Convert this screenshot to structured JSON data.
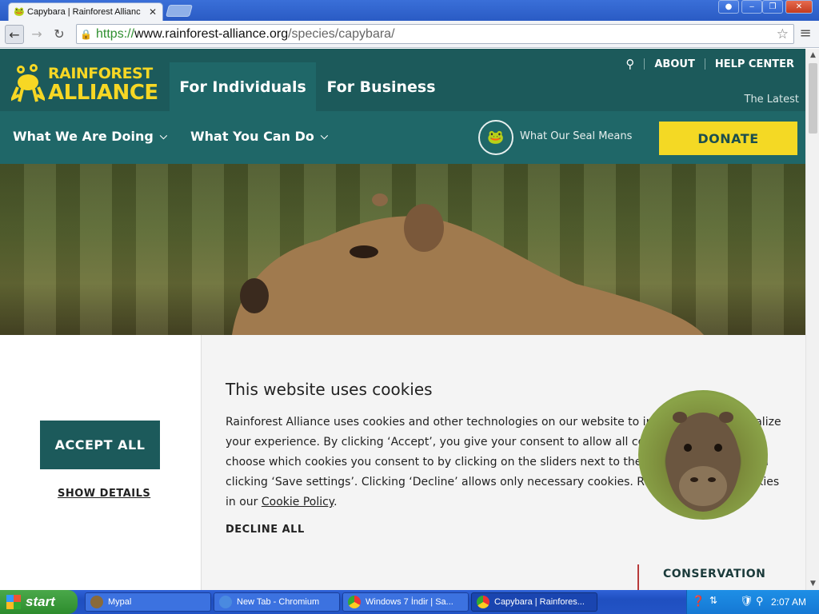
{
  "browser": {
    "tab_title": "Capybara | Rainforest Allianc",
    "url_scheme": "https://",
    "url_host": "www.rainforest-alliance.org",
    "url_path": "/species/capybara/"
  },
  "header": {
    "logo_line1": "RAINFOREST",
    "logo_line2": "ALLIANCE",
    "tab_individuals": "For Individuals",
    "tab_business": "For Business",
    "about": "ABOUT",
    "help_center": "HELP CENTER",
    "latest": "The Latest",
    "nav_doing": "What We Are Doing",
    "nav_can_do": "What You Can Do",
    "seal_text": "What Our Seal Means",
    "donate": "DONATE"
  },
  "cookie": {
    "title": "This website uses cookies",
    "body_part1": "Rainforest Alliance uses cookies and other technologies on our website to improve and personalize your experience. By clicking ‘Accept’, you give your consent to allow all cookies. You can also choose which cookies you consent to by clicking on the sliders next to the cookie categories and clicking ‘Save settings’. Clicking ‘Decline’ allows only necessary cookies. Read more about cookies in our ",
    "body_link": "Cookie Policy",
    "body_end": ".",
    "accept_all": "ACCEPT ALL",
    "show_details": "SHOW DETAILS",
    "decline_all": "DECLINE ALL"
  },
  "section": {
    "conservation": "CONSERVATION"
  },
  "taskbar": {
    "start": "start",
    "tasks": [
      "Mypal",
      "New Tab - Chromium",
      "Windows 7 İndir | Sa...",
      "Capybara | Rainfores..."
    ],
    "clock": "2:07 AM"
  },
  "colors": {
    "brand_teal": "#1c5a5b",
    "brand_yellow": "#f4d924"
  }
}
